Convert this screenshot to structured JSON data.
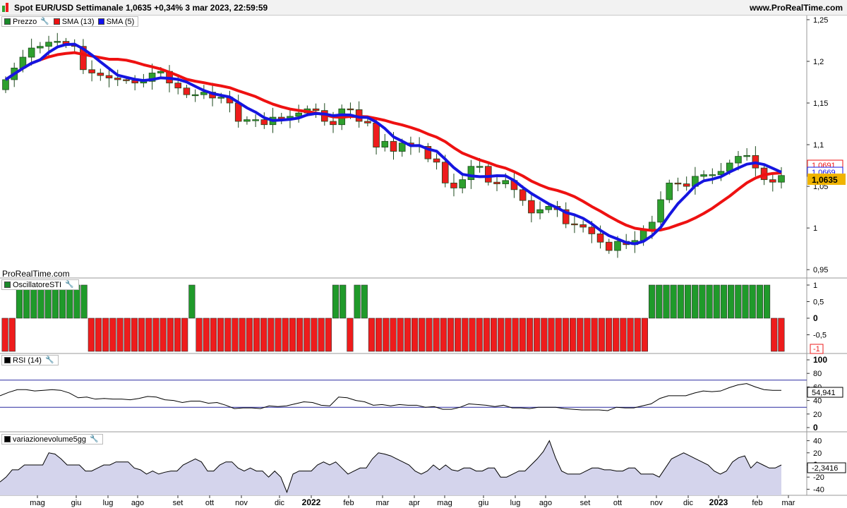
{
  "header": {
    "title": "Spot EUR/USD Settimanale 1,0635 +0,34% 3 mar 2023, 22:59:59",
    "brand": "www.ProRealTime.com"
  },
  "watermark": "ProRealTime.com",
  "legends": {
    "price": [
      {
        "label": "Prezzo",
        "color": "#1a8a2a"
      },
      {
        "label": "SMA (13)",
        "color": "#ee1111"
      },
      {
        "label": "SMA (5)",
        "color": "#1111ee"
      }
    ],
    "sti": {
      "label": "OscillatoreSTI",
      "color": "#1a8a2a"
    },
    "rsi": {
      "label": "RSI (14)",
      "color": "#000000"
    },
    "vol": {
      "label": "variazionevolume5gg",
      "color": "#000000"
    }
  },
  "colors": {
    "up": "#2ea02e",
    "down": "#ee1c1c",
    "sma13": "#ee1111",
    "sma5": "#1515e0",
    "area": "#d4d4ec",
    "price_tag": "#f0b400"
  },
  "x_labels": [
    "mag",
    "giu",
    "lug",
    "ago",
    "set",
    "ott",
    "nov",
    "dic",
    "2022",
    "feb",
    "mar",
    "apr",
    "mag",
    "giu",
    "lug",
    "ago",
    "set",
    "ott",
    "nov",
    "dic",
    "2023",
    "feb",
    "mar"
  ],
  "chart_data": [
    {
      "type": "candlestick",
      "title": "Spot EUR/USD Settimanale",
      "ylim": [
        0.94,
        1.255
      ],
      "y_ticks": [
        "1,25",
        "1,2",
        "1,15",
        "1,1",
        "1,05",
        "1",
        "0,95"
      ],
      "close_values": [
        1.178,
        1.192,
        1.205,
        1.216,
        1.218,
        1.223,
        1.224,
        1.22,
        1.218,
        1.19,
        1.186,
        1.183,
        1.18,
        1.178,
        1.177,
        1.174,
        1.176,
        1.186,
        1.188,
        1.174,
        1.168,
        1.16,
        1.16,
        1.163,
        1.156,
        1.157,
        1.15,
        1.128,
        1.13,
        1.13,
        1.124,
        1.133,
        1.131,
        1.134,
        1.138,
        1.143,
        1.141,
        1.128,
        1.124,
        1.143,
        1.142,
        1.128,
        1.126,
        1.097,
        1.104,
        1.092,
        1.102,
        1.099,
        1.098,
        1.083,
        1.079,
        1.054,
        1.048,
        1.058,
        1.074,
        1.074,
        1.055,
        1.053,
        1.057,
        1.046,
        1.033,
        1.018,
        1.022,
        1.026,
        1.022,
        1.005,
        1.004,
        1.001,
        0.993,
        0.983,
        0.973,
        0.984,
        0.98,
        0.985,
        0.998,
        1.007,
        1.034,
        1.054,
        1.053,
        1.05,
        1.062,
        1.064,
        1.064,
        1.068,
        1.078,
        1.086,
        1.087,
        1.072,
        1.058,
        1.055,
        1.063
      ],
      "series": [
        {
          "name": "SMA (13)",
          "last_value": 1.0691
        },
        {
          "name": "SMA (5)",
          "last_value": 1.0669
        }
      ],
      "last_price": "1,0635",
      "last_labels": [
        "1,0691",
        "1,0669",
        "1,0635"
      ]
    },
    {
      "type": "bar",
      "title": "OscillatoreSTI",
      "ylim": [
        -1,
        1
      ],
      "y_ticks": [
        "1",
        "0,5",
        "0",
        "-0,5"
      ],
      "values": [
        -1,
        -1,
        1,
        1,
        1,
        1,
        1,
        1,
        1,
        1,
        1,
        1,
        -1,
        -1,
        -1,
        -1,
        -1,
        -1,
        -1,
        -1,
        -1,
        -1,
        -1,
        -1,
        -1,
        -1,
        1,
        -1,
        -1,
        -1,
        -1,
        -1,
        -1,
        -1,
        -1,
        -1,
        -1,
        -1,
        -1,
        -1,
        -1,
        -1,
        -1,
        -1,
        -1,
        -1,
        1,
        1,
        -1,
        1,
        1,
        -1,
        -1,
        -1,
        -1,
        -1,
        -1,
        -1,
        -1,
        -1,
        -1,
        -1,
        -1,
        -1,
        -1,
        -1,
        -1,
        -1,
        -1,
        -1,
        -1,
        -1,
        -1,
        -1,
        -1,
        -1,
        -1,
        -1,
        -1,
        -1,
        -1,
        -1,
        -1,
        -1,
        -1,
        -1,
        -1,
        -1,
        -1,
        -1,
        1,
        1,
        1,
        1,
        1,
        1,
        1,
        1,
        1,
        1,
        1,
        1,
        1,
        1,
        1,
        1,
        1,
        -1,
        -1
      ],
      "last_label": "-1"
    },
    {
      "type": "line",
      "title": "RSI (14)",
      "ylim": [
        0,
        100
      ],
      "y_ticks": [
        "100",
        "80",
        "60",
        "40",
        "20",
        "0"
      ],
      "reference_lines": [
        70,
        30
      ],
      "values": [
        47,
        52,
        56,
        56,
        54,
        55,
        56,
        55,
        51,
        44,
        45,
        42,
        43,
        42,
        42,
        41,
        43,
        46,
        45,
        41,
        40,
        37,
        39,
        39,
        36,
        37,
        33,
        28,
        29,
        29,
        28,
        32,
        31,
        32,
        35,
        38,
        37,
        33,
        32,
        45,
        44,
        40,
        38,
        33,
        34,
        32,
        34,
        33,
        33,
        30,
        31,
        27,
        27,
        30,
        35,
        34,
        33,
        31,
        33,
        29,
        29,
        28,
        30,
        30,
        30,
        28,
        27,
        26,
        26,
        26,
        25,
        30,
        29,
        29,
        32,
        35,
        43,
        47,
        47,
        47,
        51,
        54,
        53,
        54,
        59,
        63,
        65,
        60,
        56,
        55,
        55
      ],
      "last_value": "54,941"
    },
    {
      "type": "area",
      "title": "variazionevolume5gg",
      "ylim": [
        -45,
        45
      ],
      "y_ticks": [
        "40",
        "20",
        "0",
        "-20",
        "-40"
      ],
      "values": [
        -28,
        -20,
        -8,
        -8,
        0,
        0,
        0,
        0,
        20,
        18,
        10,
        0,
        0,
        0,
        -10,
        -10,
        -5,
        0,
        0,
        5,
        5,
        5,
        -5,
        -8,
        -15,
        -10,
        -15,
        -12,
        -10,
        -10,
        0,
        5,
        10,
        5,
        -10,
        -10,
        0,
        5,
        5,
        -5,
        -10,
        -5,
        -10,
        -10,
        -20,
        -10,
        -20,
        -45,
        -15,
        -10,
        -10,
        -10,
        0,
        5,
        0,
        5,
        -5,
        -15,
        -10,
        -5,
        -5,
        10,
        20,
        18,
        15,
        10,
        5,
        0,
        -10,
        -15,
        -10,
        0,
        -8,
        0,
        -8,
        -10,
        -5,
        -5,
        -10,
        -10,
        -5,
        -5,
        -20,
        -20,
        -15,
        -10,
        -10,
        0,
        10,
        22,
        40,
        12,
        -10,
        -15,
        -15,
        -15,
        -10,
        -5,
        -5,
        -8,
        -8,
        -10,
        -10,
        -5,
        -5,
        -15,
        -15,
        -15,
        -20,
        -5,
        10,
        15,
        20,
        15,
        10,
        5,
        0,
        -10,
        -15,
        -10,
        5,
        12,
        15,
        -5,
        5,
        0,
        -5,
        -5,
        0
      ],
      "last_value": "-2,3416"
    }
  ]
}
